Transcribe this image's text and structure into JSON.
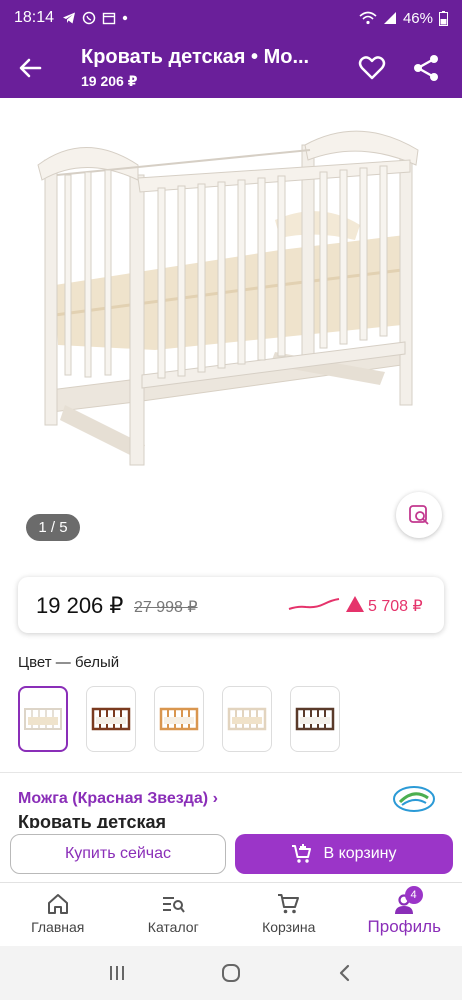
{
  "status_bar": {
    "time": "18:14",
    "battery": "46%"
  },
  "app_bar": {
    "title": "Кровать детская • Мо...",
    "subtitle": "19 206 ₽"
  },
  "gallery": {
    "counter": "1 / 5"
  },
  "price": {
    "current": "19 206 ₽",
    "old": "27 998 ₽",
    "delta": "5 708 ₽"
  },
  "color": {
    "label": "Цвет — белый",
    "options": [
      "white",
      "dark-walnut",
      "natural",
      "ivory",
      "brown"
    ]
  },
  "brand": {
    "name": "Можга (Красная Звезда) ›"
  },
  "product": {
    "name": "Кровать детская"
  },
  "actions": {
    "buy_now": "Купить сейчас",
    "to_cart": "В корзину"
  },
  "bottom_nav": {
    "items": [
      {
        "label": "Главная",
        "icon": "home-icon"
      },
      {
        "label": "Каталог",
        "icon": "catalog-search-icon"
      },
      {
        "label": "Корзина",
        "icon": "cart-icon"
      },
      {
        "label": "Профиль",
        "icon": "profile-icon",
        "badge": "4"
      }
    ]
  },
  "colors": {
    "brand": "#6a1f9a",
    "accent": "#9b35c8",
    "price_up": "#e5336b"
  }
}
